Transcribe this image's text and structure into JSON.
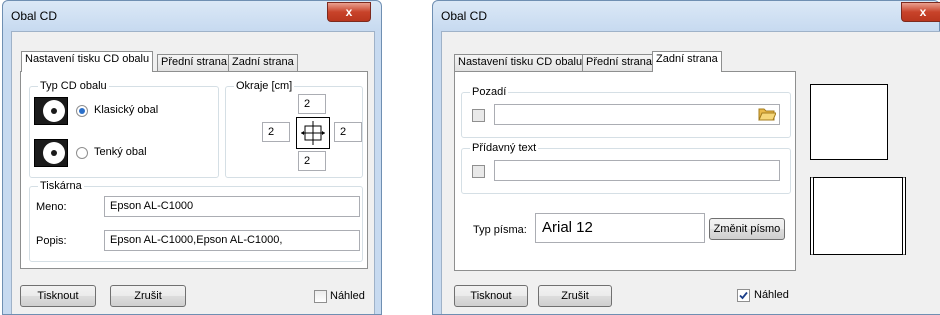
{
  "left": {
    "title": "Obal CD",
    "close": "x",
    "tabs": [
      "Nastavení tisku CD obalu",
      "Přední strana",
      "Zadní strana"
    ],
    "type_group": "Typ CD obalu",
    "radio_classic": "Klasický obal",
    "radio_thin": "Tenký obal",
    "margins_group": "Okraje [cm]",
    "margin_top": "2",
    "margin_left": "2",
    "margin_right": "2",
    "margin_bottom": "2",
    "printer_group": "Tiskárna",
    "name_label": "Meno:",
    "name_value": "Epson AL-C1000",
    "desc_label": "Popis:",
    "desc_value": "Epson AL-C1000,Epson AL-C1000,",
    "print_btn": "Tisknout",
    "cancel_btn": "Zrušit",
    "preview_label": "Náhled",
    "preview_checked": false
  },
  "right": {
    "title": "Obal CD",
    "close": "x",
    "tabs": [
      "Nastavení tisku CD obalu",
      "Přední strana",
      "Zadní strana"
    ],
    "bg_group": "Pozadí",
    "bg_value": "",
    "extra_group": "Přídavný text",
    "extra_value": "",
    "font_label": "Typ písma:",
    "font_value": "Arial 12",
    "change_font_btn": "Změnit písmo",
    "print_btn": "Tisknout",
    "cancel_btn": "Zrušit",
    "preview_label": "Náhled",
    "preview_checked": true
  }
}
